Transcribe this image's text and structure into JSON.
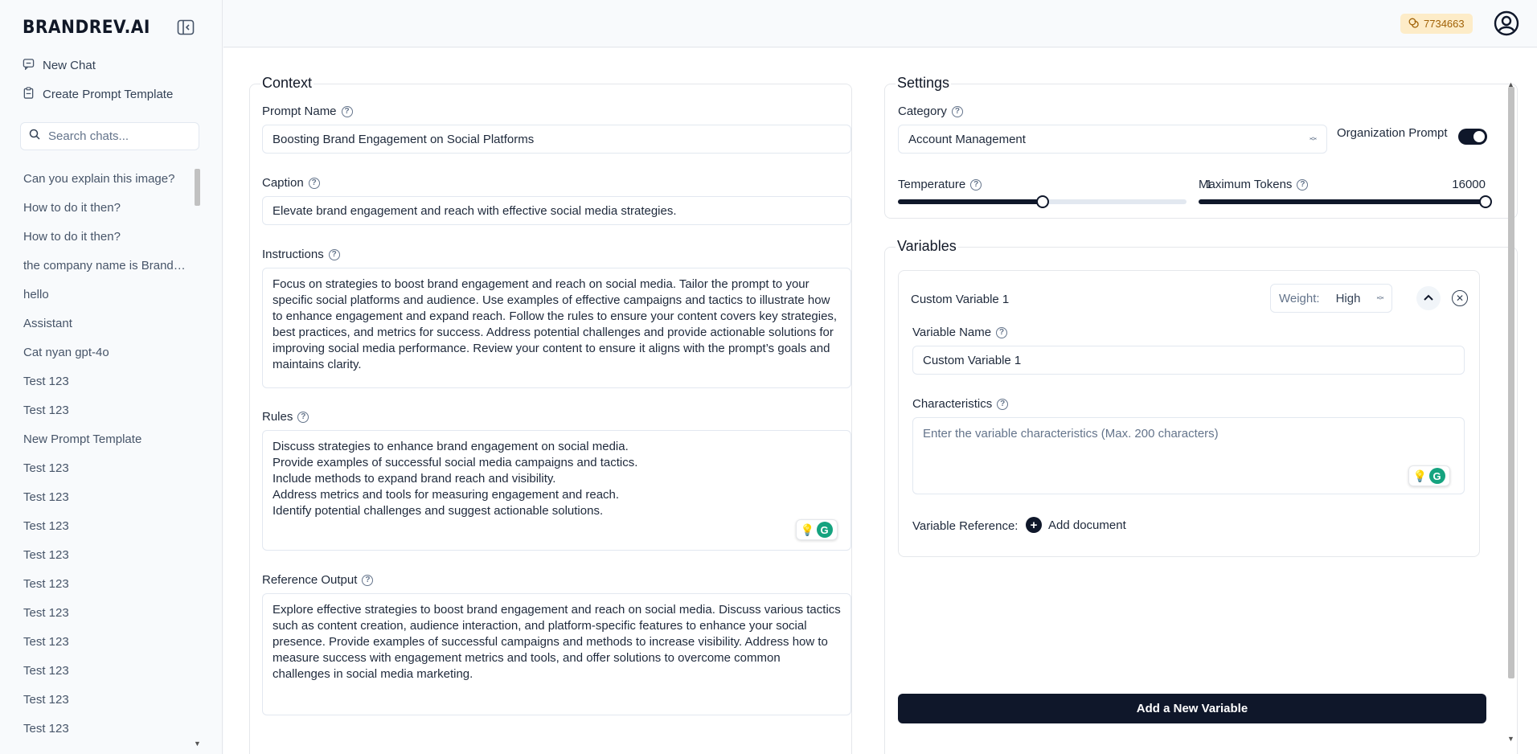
{
  "sidebar": {
    "logo": "BRANDREV.AI",
    "new_chat": "New Chat",
    "create_template": "Create Prompt Template",
    "search_placeholder": "Search chats...",
    "chats": [
      "Can you explain this image?",
      "How to do it then?",
      "How to do it then?",
      "the company name is Brandrev",
      "hello",
      "Assistant",
      "Cat nyan gpt-4o",
      "Test 123",
      "Test 123",
      "New Prompt Template",
      "Test 123",
      "Test 123",
      "Test 123",
      "Test 123",
      "Test 123",
      "Test 123",
      "Test 123",
      "Test 123",
      "Test 123",
      "Test 123"
    ]
  },
  "header": {
    "credits": "7734663"
  },
  "context": {
    "legend": "Context",
    "prompt_name_label": "Prompt Name",
    "prompt_name_value": "Boosting Brand Engagement on Social Platforms",
    "caption_label": "Caption",
    "caption_value": "Elevate brand engagement and reach with effective social media strategies.",
    "instructions_label": "Instructions",
    "instructions_value": "Focus on strategies to boost brand engagement and reach on social media. Tailor the prompt to your specific social platforms and audience. Use examples of effective campaigns and tactics to illustrate how to enhance engagement and expand reach. Follow the rules to ensure your content covers key strategies, best practices, and metrics for success. Address potential challenges and provide actionable solutions for improving social media performance. Review your content to ensure it aligns with the prompt’s goals and maintains clarity.",
    "rules_label": "Rules",
    "rules_value": "Discuss strategies to enhance brand engagement on social media.\nProvide examples of successful social media campaigns and tactics.\nInclude methods to expand brand reach and visibility.\nAddress metrics and tools for measuring engagement and reach.\nIdentify potential challenges and suggest actionable solutions.",
    "reference_label": "Reference Output",
    "reference_value": "Explore effective strategies to boost brand engagement and reach on social media. Discuss various tactics such as content creation, audience interaction, and platform-specific features to enhance your social presence. Provide examples of successful campaigns and methods to increase visibility. Address how to measure success with engagement metrics and tools, and offer solutions to overcome common challenges in social media marketing."
  },
  "settings": {
    "legend": "Settings",
    "category_label": "Category",
    "category_value": "Account Management",
    "org_prompt_label": "Organization Prompt",
    "org_prompt_on": true,
    "temperature_label": "Temperature",
    "temperature_value": "1",
    "temperature_fraction": 0.5,
    "max_tokens_label": "Maximum Tokens",
    "max_tokens_value": "16000",
    "max_tokens_fraction": 1.0
  },
  "variables": {
    "legend": "Variables",
    "items": [
      {
        "title": "Custom Variable 1",
        "weight_label": "Weight:",
        "weight_value": "High",
        "name_label": "Variable Name",
        "name_value": "Custom Variable 1",
        "characteristics_label": "Characteristics",
        "characteristics_placeholder": "Enter the variable characteristics (Max. 200 characters)",
        "reference_label": "Variable Reference:",
        "add_document": "Add document"
      }
    ],
    "add_button": "Add a New Variable"
  }
}
